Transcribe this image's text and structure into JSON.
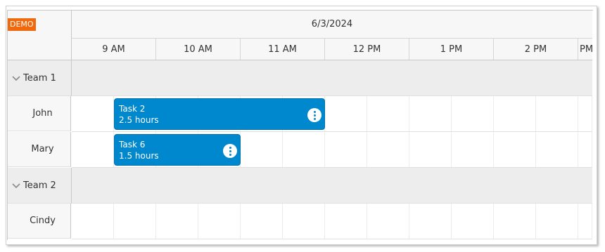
{
  "badge": "DEMO",
  "header": {
    "date": "6/3/2024",
    "hours": [
      "9 AM",
      "10 AM",
      "11 AM",
      "12 PM",
      "1 PM",
      "2 PM",
      "PM"
    ]
  },
  "rows": {
    "team1": "Team 1",
    "john": "John",
    "mary": "Mary",
    "team2": "Team 2",
    "cindy": "Cindy"
  },
  "events": {
    "task2": {
      "title": "Task 2",
      "duration": "2.5 hours"
    },
    "task6": {
      "title": "Task 6",
      "duration": "1.5 hours"
    }
  },
  "colors": {
    "event": "#0088cf",
    "badge": "#f06a0d",
    "group_row": "#ededed"
  }
}
